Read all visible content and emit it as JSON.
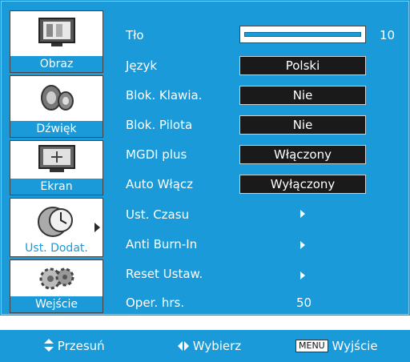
{
  "sidebar": {
    "items": [
      {
        "label": "Obraz",
        "icon": "tv-screen-icon",
        "selected": false
      },
      {
        "label": "Dźwięk",
        "icon": "speaker-icon",
        "selected": false
      },
      {
        "label": "Ekran",
        "icon": "monitor-icon",
        "selected": false
      },
      {
        "label": "Ust. Dodat.",
        "icon": "clock-globe-icon",
        "selected": true
      },
      {
        "label": "Wejście",
        "icon": "gears-icon",
        "selected": false
      }
    ]
  },
  "menu": {
    "tlo": {
      "label": "Tło",
      "value": "10",
      "level": 1.0
    },
    "jezyk": {
      "label": "Język",
      "value": "Polski"
    },
    "blok_klawia": {
      "label": "Blok. Klawia.",
      "value": "Nie"
    },
    "blok_pilota": {
      "label": "Blok. Pilota",
      "value": "Nie"
    },
    "mgdi": {
      "label": "MGDI plus",
      "value": "Włączony"
    },
    "auto_wlacz": {
      "label": "Auto Włącz",
      "value": "Wyłączony"
    },
    "ust_czasu": {
      "label": "Ust. Czasu"
    },
    "anti_burn": {
      "label": "Anti Burn-In"
    },
    "reset": {
      "label": "Reset Ustaw."
    },
    "oper_hrs": {
      "label": "Oper. hrs.",
      "value": "50"
    }
  },
  "footer": {
    "move_label": "Przesuń",
    "select_label": "Wybierz",
    "menu_key": "MENU",
    "exit_label": "Wyjście"
  },
  "colors": {
    "accent": "#1a9ad8",
    "value_box": "#1a1a1a"
  }
}
